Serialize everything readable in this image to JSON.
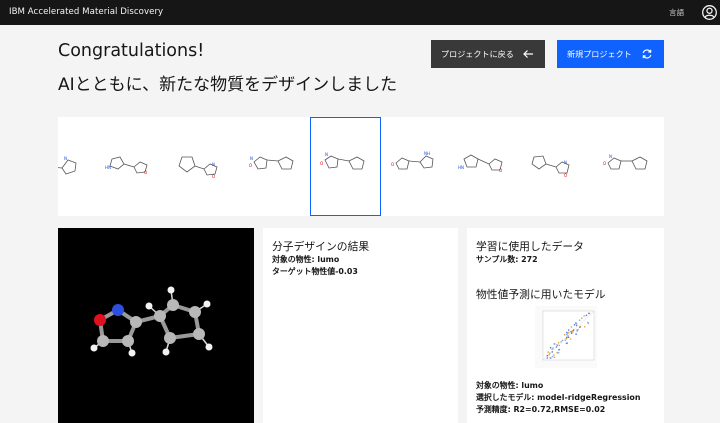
{
  "header": {
    "brand": "IBM Accelerated Material Discovery",
    "language": "言語"
  },
  "hero": {
    "title": "Congratulations!",
    "subtitle": "AIとともに、新たな物質をデザインしました"
  },
  "actions": {
    "back_label": "プロジェクトに戻る",
    "new_label": "新規プロジェクト"
  },
  "carousel": {
    "selected_index": 4,
    "item_count": 9
  },
  "result": {
    "title": "分子デザインの結果",
    "property_label": "対象の物性: ",
    "property_value": "lumo",
    "target_label": "ターゲット物性値",
    "target_value": "-0.03"
  },
  "training": {
    "title": "学習に使用したデータ",
    "samples_label": "サンプル数: ",
    "samples_value": "272"
  },
  "model": {
    "title": "物性値予測に用いたモデル",
    "property_label": "対象の物性: ",
    "property_value": "lumo",
    "model_label": "選択したモデル: ",
    "model_value": "model-ridgeRegression",
    "accuracy_label": "予測精度: ",
    "accuracy_value": "R2=0.72,RMSE=0.02"
  },
  "colors": {
    "topbar": "#161616",
    "primary": "#0f62fe",
    "secondary": "#393939",
    "background": "#f4f4f4"
  },
  "icons": {
    "back": "arrow-left-icon",
    "new": "renew-icon",
    "user": "user-avatar-icon"
  }
}
